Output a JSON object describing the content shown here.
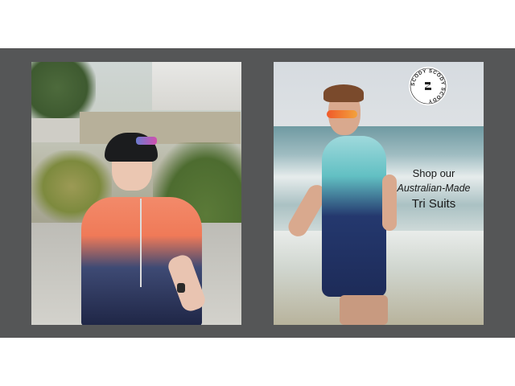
{
  "banner": {
    "background_color": "#555657",
    "left_photo": {
      "subject": "cyclist-photo"
    },
    "right_photo": {
      "subject": "triathlete-photo",
      "logo": {
        "text": "SCODY SCODY SCODY",
        "icon": "scody-logo-icon"
      },
      "promo": {
        "line1": "Shop our",
        "line2": "Australian-Made",
        "line3": "Tri Suits"
      }
    }
  }
}
